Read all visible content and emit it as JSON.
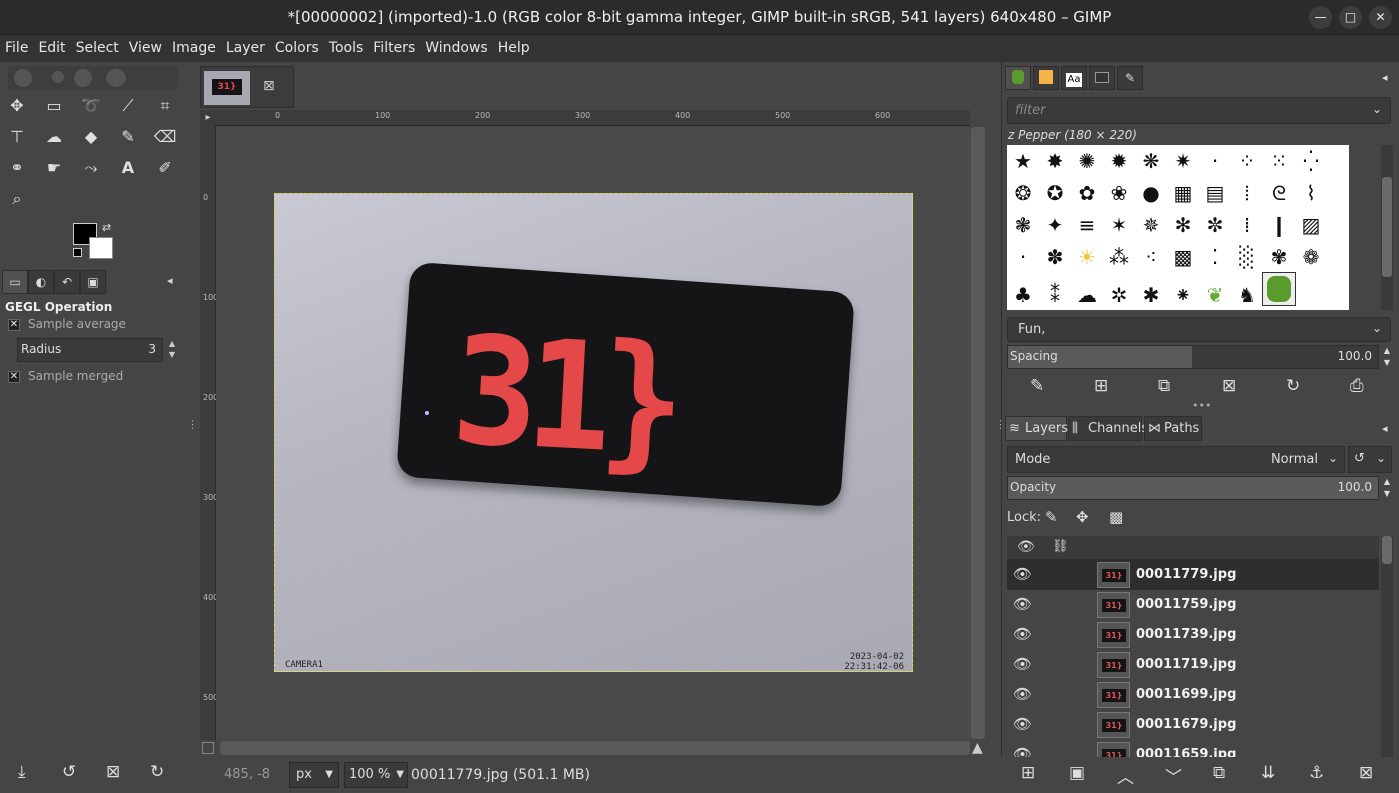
{
  "window": {
    "title": "*[00000002] (imported)-1.0 (RGB color 8-bit gamma integer, GIMP built-in sRGB, 541 layers) 640x480 – GIMP"
  },
  "menu": [
    "File",
    "Edit",
    "Select",
    "View",
    "Image",
    "Layer",
    "Colors",
    "Tools",
    "Filters",
    "Windows",
    "Help"
  ],
  "tool_options": {
    "heading": "GEGL Operation",
    "sample_average_label": "Sample average",
    "radius_label": "Radius",
    "radius_value": "3",
    "sample_merged_label": "Sample merged"
  },
  "image": {
    "display_text": "31}",
    "stamp_camera": "CAMERA1",
    "stamp_date": "2023-04-02",
    "stamp_time": "22:31:42-06"
  },
  "rulers": {
    "top": [
      "0",
      "100",
      "200",
      "300",
      "400",
      "500",
      "600"
    ],
    "left": [
      "0",
      "100",
      "200",
      "300",
      "400",
      "500"
    ]
  },
  "status": {
    "coords": "485, -8",
    "unit": "px",
    "zoom": "100 %",
    "info": "00011779.jpg (501.1 MB)"
  },
  "brushes": {
    "filter_placeholder": "filter",
    "current": "z Pepper (180 × 220)",
    "tag": "Fun,",
    "spacing_label": "Spacing",
    "spacing_value": "100.0"
  },
  "layers_panel": {
    "tabs": [
      "Layers",
      "Channels",
      "Paths"
    ],
    "mode_label": "Mode",
    "mode_value": "Normal",
    "opacity_label": "Opacity",
    "opacity_value": "100.0",
    "lock_label": "Lock:",
    "layers": [
      "00011779.jpg",
      "00011759.jpg",
      "00011739.jpg",
      "00011719.jpg",
      "00011699.jpg",
      "00011679.jpg",
      "00011659.jpg"
    ]
  },
  "colors": {
    "accent_selection": "#e8d64a",
    "digits": "#e44848"
  }
}
